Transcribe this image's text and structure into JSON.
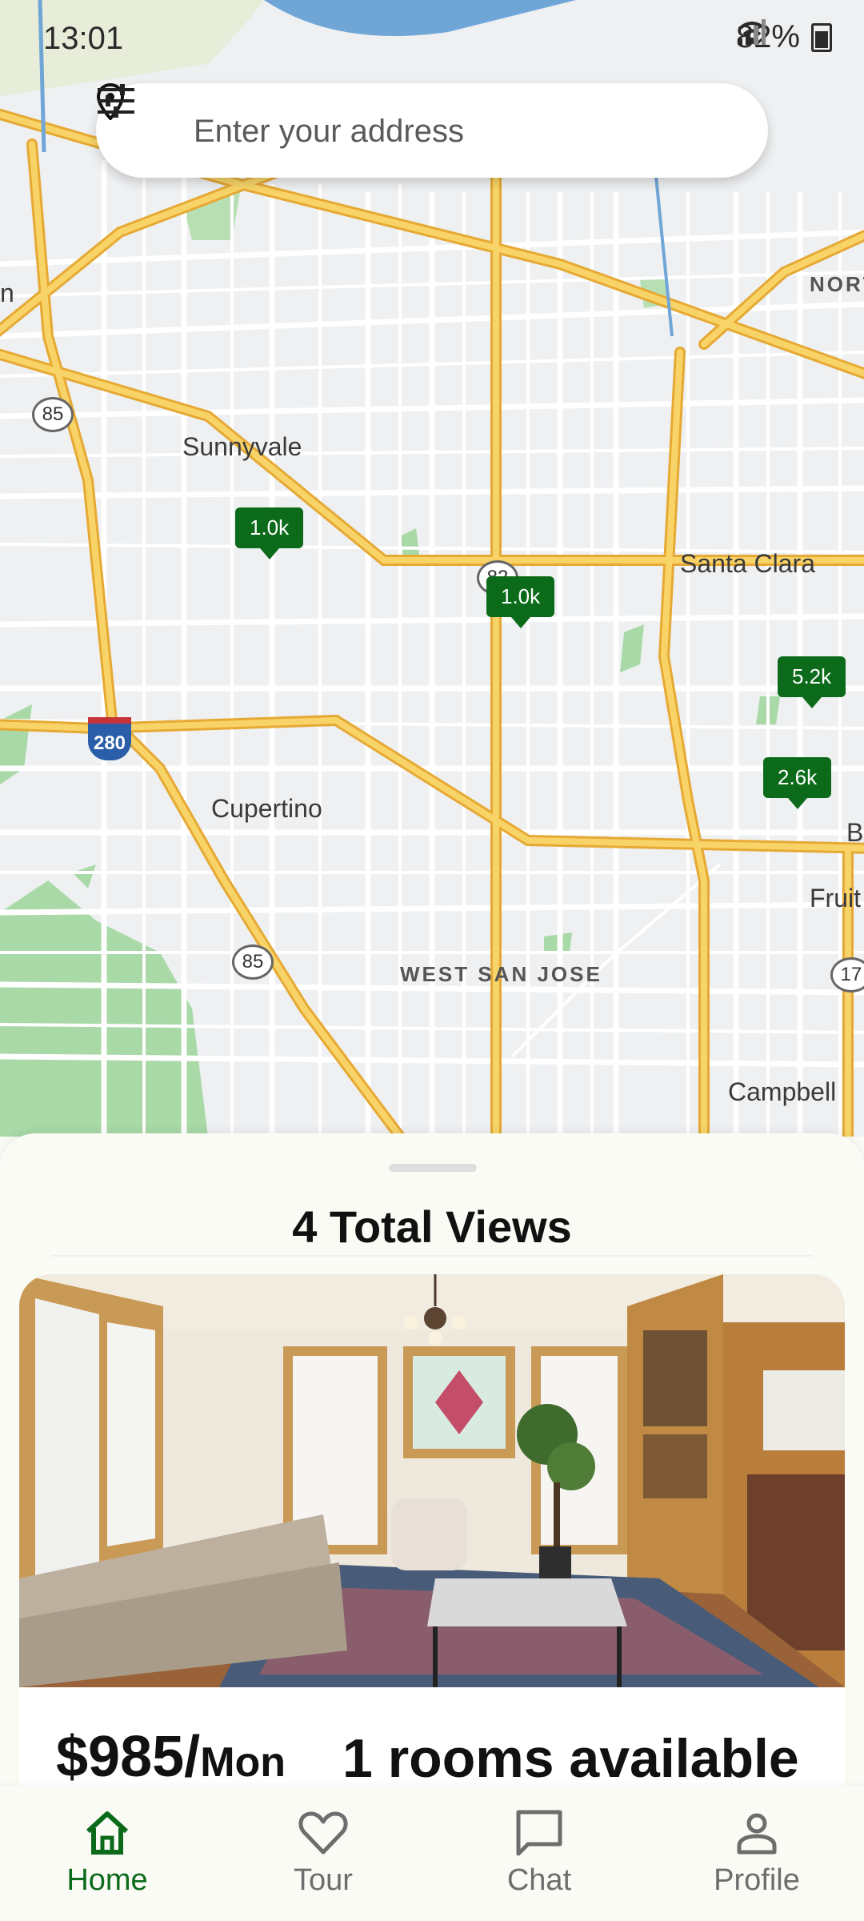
{
  "status_bar": {
    "time": "13:01",
    "battery": "82%"
  },
  "search": {
    "placeholder": "Enter your address"
  },
  "map": {
    "place_labels": [
      "Sunnyvale",
      "Santa Clara",
      "Cupertino",
      "WEST SAN JOSE",
      "Campbell",
      "NORT",
      "Fruit",
      "B",
      "n"
    ],
    "route_shields": [
      "85",
      "85",
      "82",
      "280",
      "17"
    ],
    "price_markers": [
      "1.0k",
      "1.0k",
      "5.2k",
      "2.6k"
    ]
  },
  "sheet": {
    "title": "4 Total Views",
    "listing": {
      "price": "$985/",
      "price_unit": "Mon",
      "availability": "1 rooms available"
    }
  },
  "nav": {
    "items": [
      {
        "label": "Home",
        "icon": "home-icon",
        "active": true
      },
      {
        "label": "Tour",
        "icon": "heart-icon",
        "active": false
      },
      {
        "label": "Chat",
        "icon": "chat-icon",
        "active": false
      },
      {
        "label": "Profile",
        "icon": "profile-icon",
        "active": false
      }
    ]
  },
  "colors": {
    "accent": "#0c6b1b",
    "highway": "#f6c34a",
    "map_bg": "#eef0f2",
    "park": "#a9d9a7",
    "water": "#6fa6d6"
  }
}
